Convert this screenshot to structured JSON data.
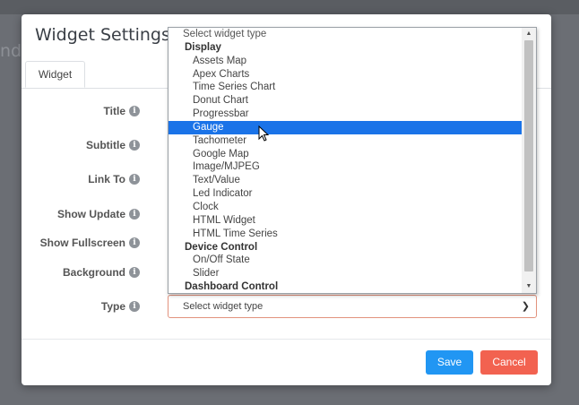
{
  "modal": {
    "title": "Widget Settings",
    "tab": "Widget",
    "form": [
      {
        "label": "Title"
      },
      {
        "label": "Subtitle"
      },
      {
        "label": "Link To"
      },
      {
        "label": "Show Update"
      },
      {
        "label": "Show Fullscreen"
      },
      {
        "label": "Background"
      },
      {
        "label": "Type"
      }
    ],
    "type_select": {
      "value": "Select widget type"
    },
    "buttons": {
      "save": "Save",
      "cancel": "Cancel"
    }
  },
  "dropdown": {
    "options": [
      {
        "text": "Select widget type",
        "kind": "placeholder"
      },
      {
        "text": "Display",
        "kind": "group"
      },
      {
        "text": "Assets Map",
        "kind": "item"
      },
      {
        "text": "Apex Charts",
        "kind": "item"
      },
      {
        "text": "Time Series Chart",
        "kind": "item"
      },
      {
        "text": "Donut Chart",
        "kind": "item"
      },
      {
        "text": "Progressbar",
        "kind": "item"
      },
      {
        "text": "Gauge",
        "kind": "item",
        "selected": true
      },
      {
        "text": "Tachometer",
        "kind": "item"
      },
      {
        "text": "Google Map",
        "kind": "item"
      },
      {
        "text": "Image/MJPEG",
        "kind": "item"
      },
      {
        "text": "Text/Value",
        "kind": "item"
      },
      {
        "text": "Led Indicator",
        "kind": "item"
      },
      {
        "text": "Clock",
        "kind": "item"
      },
      {
        "text": "HTML Widget",
        "kind": "item"
      },
      {
        "text": "HTML Time Series",
        "kind": "item"
      },
      {
        "text": "Device Control",
        "kind": "group"
      },
      {
        "text": "On/Off State",
        "kind": "item"
      },
      {
        "text": "Slider",
        "kind": "item"
      },
      {
        "text": "Dashboard Control",
        "kind": "group"
      }
    ]
  },
  "background_page": {
    "partial_text": "nd"
  },
  "colors": {
    "overlay": "#6b6e74",
    "highlight": "#1a73e8",
    "save": "#2196f3",
    "cancel": "#f26250",
    "error_border": "#e2927d"
  },
  "icons": {
    "info": "info-icon",
    "cursor": "mouse-pointer-icon",
    "chevron": "chevron-down-icon"
  }
}
